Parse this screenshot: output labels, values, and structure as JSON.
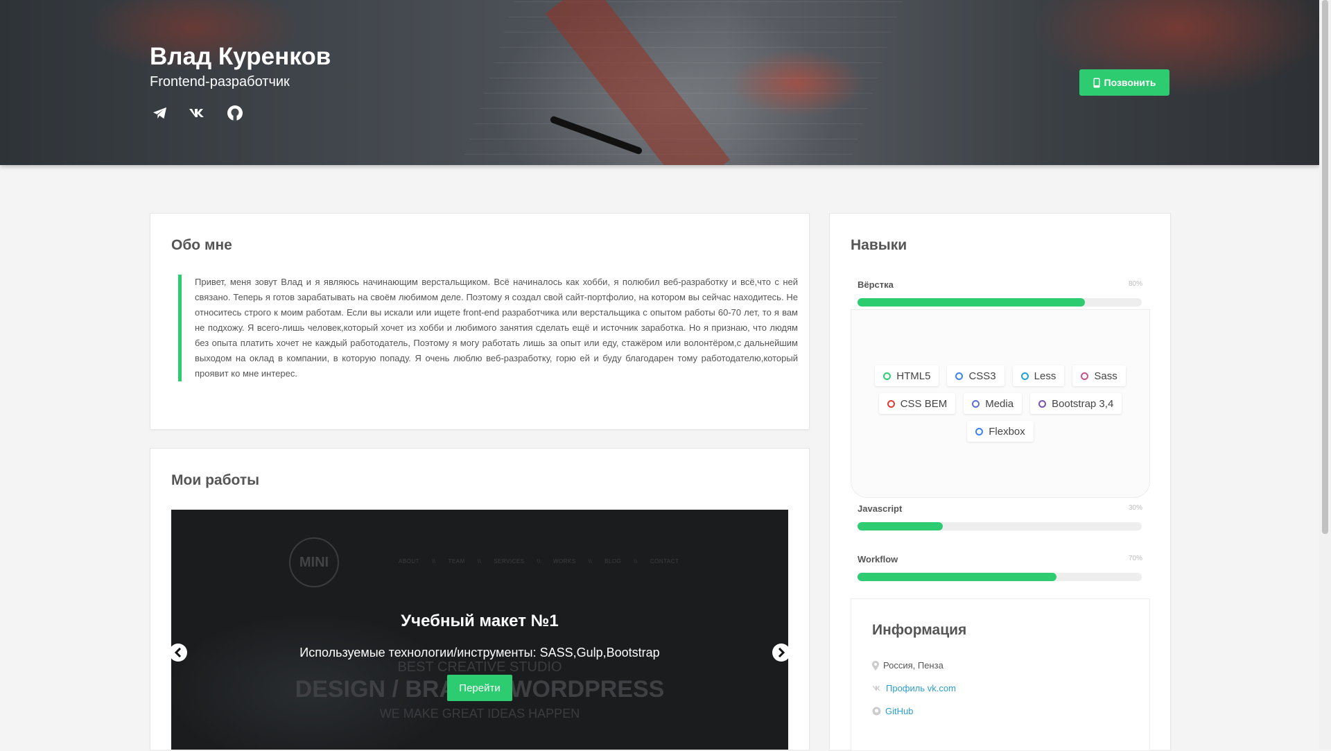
{
  "header": {
    "name": "Влад Куренков",
    "role": "Frontend-разработчик",
    "call_label": "Позвонить",
    "socials": [
      "telegram-icon",
      "vk-icon",
      "github-icon"
    ]
  },
  "about": {
    "title": "Обо мне",
    "text": "Привет, меня зовут Влад и я являюсь начинающим верстальщиком. Всё начиналось как хобби, я полюбил веб-разработку и всё,что с ней связано. Теперь я готов зарабатывать на своём любимом деле. Поэтому я создал свой сайт-портфолио, на котором вы сейчас находитесь. Не относитесь строго к моим работам. Если вы искали или ищете front-end разработчика или верстальщика с опытом работы 60-70 лет, то я вам не подхожу. Я всего-лишь человек,который хочет из хобби и любимого занятия сделать ещё и источник заработка. Но я признаю, что людям без опыта платить хочет не каждый работодатель, Поэтому я могу работать лишь за опыт или еду, стажёром или волонтёром,с дальнейшим выходом на оклад в компании, в которую попаду. Я очень люблю веб-разработку, горю ей и буду благодарен тому работодателю,который проявит ко мне интерес."
  },
  "works": {
    "title": "Мои работы",
    "slide": {
      "logo": "MINI",
      "nav": [
        "ABOUT",
        "\\\\",
        "TEAM",
        "\\\\",
        "SERVICES",
        "\\\\",
        "WORKS",
        "\\\\",
        "BLOG",
        "\\\\",
        "CONTACT"
      ],
      "bg_line1": "BEST CREATIVE STUDIO",
      "bg_line2": "DESIGN / BRAND / WORDPRESS",
      "bg_line3": "WE MAKE GREAT IDEAS HAPPEN",
      "title": "Учебный макет №1",
      "description": "Используемые технологии/инструменты: SASS,Gulp,Bootstrap",
      "button": "Перейти"
    }
  },
  "skills": {
    "title": "Навыки",
    "items": [
      {
        "label": "Вёрстка",
        "percent_text": "80%",
        "value": 0.8
      },
      {
        "label": "Javascript",
        "percent_text": "30%",
        "value": 0.3
      },
      {
        "label": "Workflow",
        "percent_text": "70%",
        "value": 0.7
      }
    ],
    "tags": [
      {
        "label": "HTML5",
        "color": "#2ecc71"
      },
      {
        "label": "CSS3",
        "color": "#3b82f6"
      },
      {
        "label": "Less",
        "color": "#1ba3d8"
      },
      {
        "label": "Sass",
        "color": "#c6538c"
      },
      {
        "label": "CSS BEM",
        "color": "#e53935"
      },
      {
        "label": "Media",
        "color": "#5b6ee1"
      },
      {
        "label": "Bootstrap 3,4",
        "color": "#7952b3"
      },
      {
        "label": "Flexbox",
        "color": "#3b82f6"
      }
    ]
  },
  "info": {
    "title": "Информация",
    "location": "Россия, Пенза",
    "vk_link": "Профиль vk.com",
    "github_link": "GitHub"
  },
  "colors": {
    "accent": "#2ecc71",
    "link": "#2b9fd1"
  }
}
